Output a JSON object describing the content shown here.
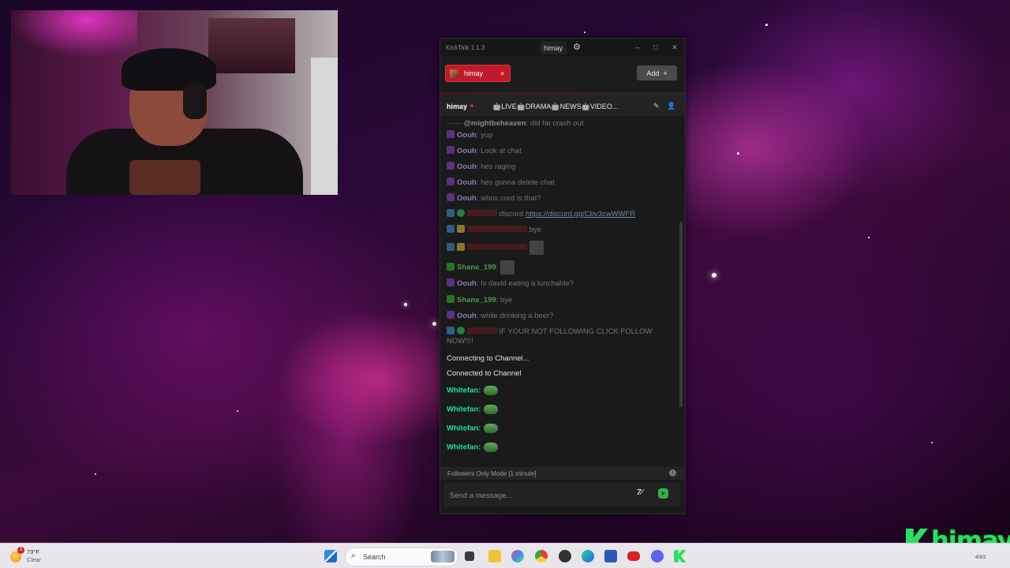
{
  "chat_app": {
    "title": "KickTalk 1.1.3",
    "user": "himay",
    "tab": {
      "label": "himay"
    },
    "add_button": {
      "label": "Add",
      "icon": "plus-icon"
    },
    "channel": {
      "name": "himay",
      "stream_title": "🤖LIVE🤖DRAMA🤖NEWS🤖VIDEO..."
    },
    "messages": [
      {
        "user": "@mightbeheaven",
        "text": "did he crash out"
      },
      {
        "user": "Oouh",
        "text": "yup"
      },
      {
        "user": "Oouh",
        "text": "Look at chat"
      },
      {
        "user": "Oouh",
        "text": "hes raging"
      },
      {
        "user": "Oouh",
        "text": "hes gunna delete chat"
      },
      {
        "user": "Oouh",
        "text": "whos cord is that?"
      },
      {
        "user": "",
        "text": "discord",
        "link": "https://discord.gg/Cbv3cwWWFR"
      },
      {
        "user": "",
        "text": "bye"
      },
      {
        "user": "",
        "text": ""
      },
      {
        "user": "Shane_199",
        "text": ""
      },
      {
        "user": "Oouh",
        "text": "Is david eating a lunchable?"
      },
      {
        "user": "Shane_199",
        "text": "bye"
      },
      {
        "user": "Oouh",
        "text": "while drinking a beer?"
      },
      {
        "user": "",
        "text": "IF YOUR NOT FOLLOWING CLICK FOLLOW",
        "text2": "NOW!!!!"
      }
    ],
    "system": {
      "connecting": "Connecting to Channel...",
      "connected": "Connected to Channel"
    },
    "whitefan": {
      "user": "Whitefan:",
      "emote": "pepe-emote"
    },
    "mode": "Followers Only Mode [1 minute]",
    "input": {
      "placeholder": "Send a message..."
    }
  },
  "taskbar": {
    "temperature": "73°F",
    "condition": "Clear",
    "weather_badge": "3",
    "search_label": "Search",
    "date": "4/3/2"
  },
  "overlay": {
    "logo_text": "himay"
  },
  "colors": {
    "kick_green": "#28e060",
    "tab_red": "#c01a2a",
    "send_green": "#31b24a"
  }
}
